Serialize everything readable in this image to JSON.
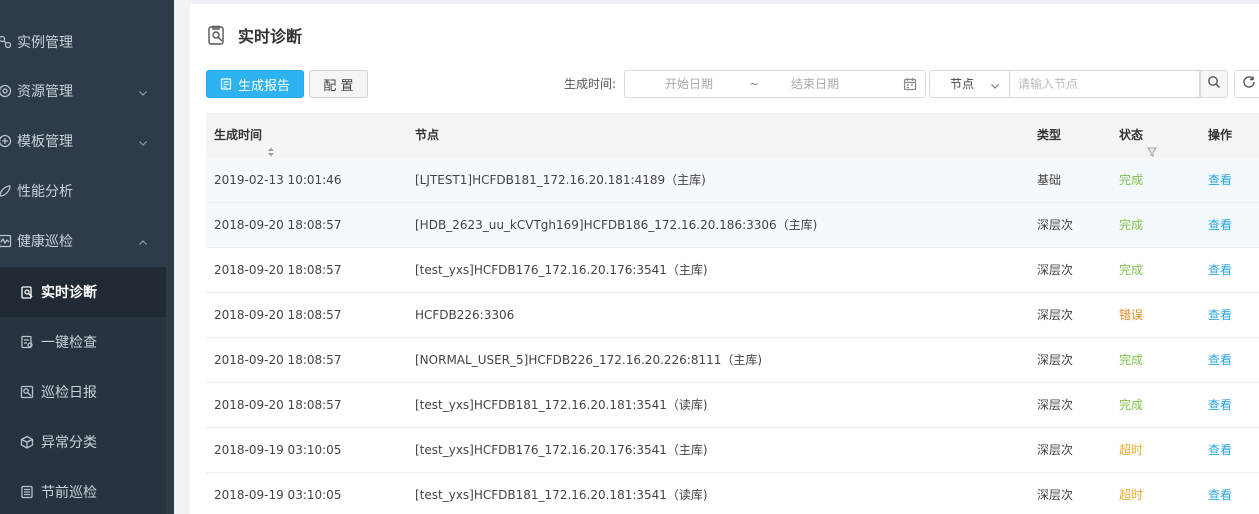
{
  "sidebar": {
    "items": [
      {
        "label": "实例管理",
        "icon": "instance-icon",
        "chevron": false
      },
      {
        "label": "资源管理",
        "icon": "resource-icon",
        "chevron": true
      },
      {
        "label": "模板管理",
        "icon": "template-icon",
        "chevron": true
      },
      {
        "label": "性能分析",
        "icon": "performance-icon",
        "chevron": false
      },
      {
        "label": "健康巡检",
        "icon": "health-icon",
        "chevron": true,
        "expanded": true
      }
    ],
    "subitems": [
      {
        "label": "实时诊断",
        "icon": "diagnosis-icon",
        "active": true
      },
      {
        "label": "一键检查",
        "icon": "check-icon",
        "active": false
      },
      {
        "label": "巡检日报",
        "icon": "report-icon",
        "active": false
      },
      {
        "label": "异常分类",
        "icon": "anomaly-icon",
        "active": false
      },
      {
        "label": "节前巡检",
        "icon": "holiday-icon",
        "active": false
      }
    ]
  },
  "page": {
    "title": "实时诊断"
  },
  "toolbar": {
    "generate_label": "生成报告",
    "config_label": "配 置",
    "time_label": "生成时间:",
    "start_placeholder": "开始日期",
    "range_sep": "~",
    "end_placeholder": "结束日期",
    "node_select_value": "节点",
    "node_input_placeholder": "请输入节点"
  },
  "table": {
    "headers": {
      "time": "生成时间",
      "node": "节点",
      "type": "类型",
      "status": "状态",
      "action": "操作"
    },
    "rows": [
      {
        "time": "2019-02-13 10:01:46",
        "node": "[LJTEST1]HCFDB181_172.16.20.181:4189（主库)",
        "type": "基础",
        "status": "完成",
        "status_kind": "ok",
        "action": "查看"
      },
      {
        "time": "2018-09-20 18:08:57",
        "node": "[HDB_2623_uu_kCVTgh169]HCFDB186_172.16.20.186:3306（主库)",
        "type": "深层次",
        "status": "完成",
        "status_kind": "ok",
        "action": "查看"
      },
      {
        "time": "2018-09-20 18:08:57",
        "node": "[test_yxs]HCFDB176_172.16.20.176:3541（主库)",
        "type": "深层次",
        "status": "完成",
        "status_kind": "ok",
        "action": "查看"
      },
      {
        "time": "2018-09-20 18:08:57",
        "node": "HCFDB226:3306",
        "type": "深层次",
        "status": "错误",
        "status_kind": "err",
        "action": "查看"
      },
      {
        "time": "2018-09-20 18:08:57",
        "node": "[NORMAL_USER_5]HCFDB226_172.16.20.226:8111（主库)",
        "type": "深层次",
        "status": "完成",
        "status_kind": "ok",
        "action": "查看"
      },
      {
        "time": "2018-09-20 18:08:57",
        "node": "[test_yxs]HCFDB181_172.16.20.181:3541（读库)",
        "type": "深层次",
        "status": "完成",
        "status_kind": "ok",
        "action": "查看"
      },
      {
        "time": "2018-09-19 03:10:05",
        "node": "[test_yxs]HCFDB176_172.16.20.176:3541（主库)",
        "type": "深层次",
        "status": "超时",
        "status_kind": "timeout",
        "action": "查看"
      },
      {
        "time": "2018-09-19 03:10:05",
        "node": "[test_yxs]HCFDB181_172.16.20.181:3541（读库)",
        "type": "深层次",
        "status": "超时",
        "status_kind": "timeout",
        "action": "查看"
      }
    ]
  },
  "colors": {
    "primary": "#2db3f0",
    "sidebar_bg": "#2e3b48",
    "ok": "#7fc24b",
    "error": "#e08a1e",
    "timeout": "#e7a92a",
    "link": "#2aa6df"
  }
}
